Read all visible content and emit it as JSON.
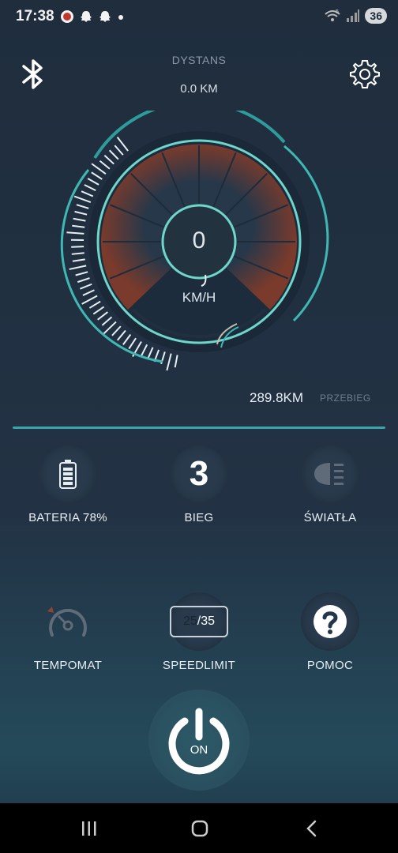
{
  "status_bar": {
    "time": "17:38",
    "notification_icons": [
      "app-notification-icon",
      "snapchat-icon",
      "snapchat-icon",
      "dot-icon"
    ],
    "wifi_label": "5",
    "battery": "36"
  },
  "header": {
    "distance_label": "DYSTANS",
    "distance_value": "0.0 KM"
  },
  "speedometer": {
    "speed": "0",
    "unit": "KM/H"
  },
  "odometer": {
    "value": "289.8KM",
    "label": "PRZEBIEG"
  },
  "tiles": {
    "battery": {
      "label": "BATERIA 78%",
      "icon": "battery-icon"
    },
    "gear": {
      "label": "BIEG",
      "value": "3"
    },
    "lights": {
      "label": "ŚWIATŁA",
      "icon": "headlight-icon"
    },
    "cruise": {
      "label": "TEMPOMAT",
      "icon": "speedometer-icon"
    },
    "speedlimit": {
      "label": "SPEEDLIMIT",
      "current": "25",
      "max": "35"
    },
    "help": {
      "label": "POMOC",
      "icon": "help-icon"
    }
  },
  "power": {
    "label": "ON"
  },
  "colors": {
    "accent": "#3aa5a8",
    "gauge_fill": "#7a3a2c",
    "background": "#1f2d3d"
  }
}
